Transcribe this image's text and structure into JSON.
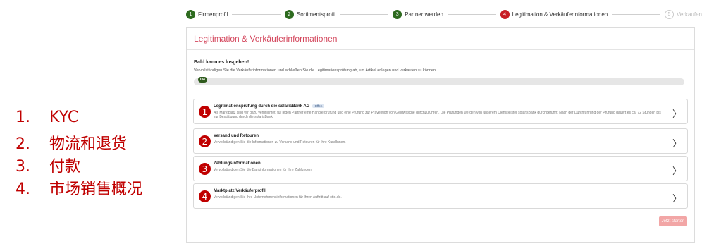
{
  "annotations": [
    {
      "num": "1.",
      "text": "KYC"
    },
    {
      "num": "2.",
      "text": "物流和退货"
    },
    {
      "num": "3.",
      "text": "付款"
    },
    {
      "num": "4.",
      "text": "市场销售概况"
    }
  ],
  "stepper": {
    "steps": [
      {
        "num": "1",
        "label": "Firmenprofil",
        "state": "done"
      },
      {
        "num": "2",
        "label": "Sortimentsprofil",
        "state": "done"
      },
      {
        "num": "3",
        "label": "Partner werden",
        "state": "done"
      },
      {
        "num": "4",
        "label": "Legitimation & Verkäuferinformationen",
        "state": "active"
      },
      {
        "num": "5",
        "label": "Verkaufen",
        "state": "next"
      }
    ]
  },
  "panel": {
    "title": "Legitimation & Verkäuferinformationen",
    "intro_title": "Bald kann es losgehen!",
    "intro_text": "Vervollständigen Sie die Verkäuferinformationen und schließen Sie die Legitimationsprüfung ab, um Artikel anlegen und verkaufen zu können.",
    "progress_label": "0/4",
    "progress_fraction": 0,
    "tasks": [
      {
        "num": "1",
        "title": "Legitimationsprüfung durch die solarisBank AG",
        "badge": "Offen",
        "text": "Als Marktplatz sind wir dazu verpflichtet, für jeden Partner eine Händlerprüfung und eine Prüfung zur Prävention von Geldwäsche durchzuführen. Die Prüfungen werden von unserem Dienstleister solarisBank durchgeführt. Nach der Durchführung der Prüfung dauert es ca. 72 Stunden bis zur Bestätigung durch die solarisBank."
      },
      {
        "num": "2",
        "title": "Versand und Retouren",
        "badge": "",
        "text": "Vervollständigen Sie die Informationen zu Versand und Retouren für Ihre KundInnen."
      },
      {
        "num": "3",
        "title": "Zahlungsinformationen",
        "badge": "",
        "text": "Vervollständigen Sie die Bankinformationen für Ihre Zahlungen."
      },
      {
        "num": "4",
        "title": "Marktplatz Verkäuferprofil",
        "badge": "",
        "text": "Vervollständigen Sie Ihre Unternehmensinformationen für Ihren Auftritt auf otto.de."
      }
    ],
    "chevron": "〉",
    "start_label": "Jetzt starten"
  },
  "colors": {
    "accent_red": "#c00000",
    "done_green": "#2e6b1f",
    "title_pink": "#d4475d",
    "button_disabled": "#f2a6a6"
  }
}
